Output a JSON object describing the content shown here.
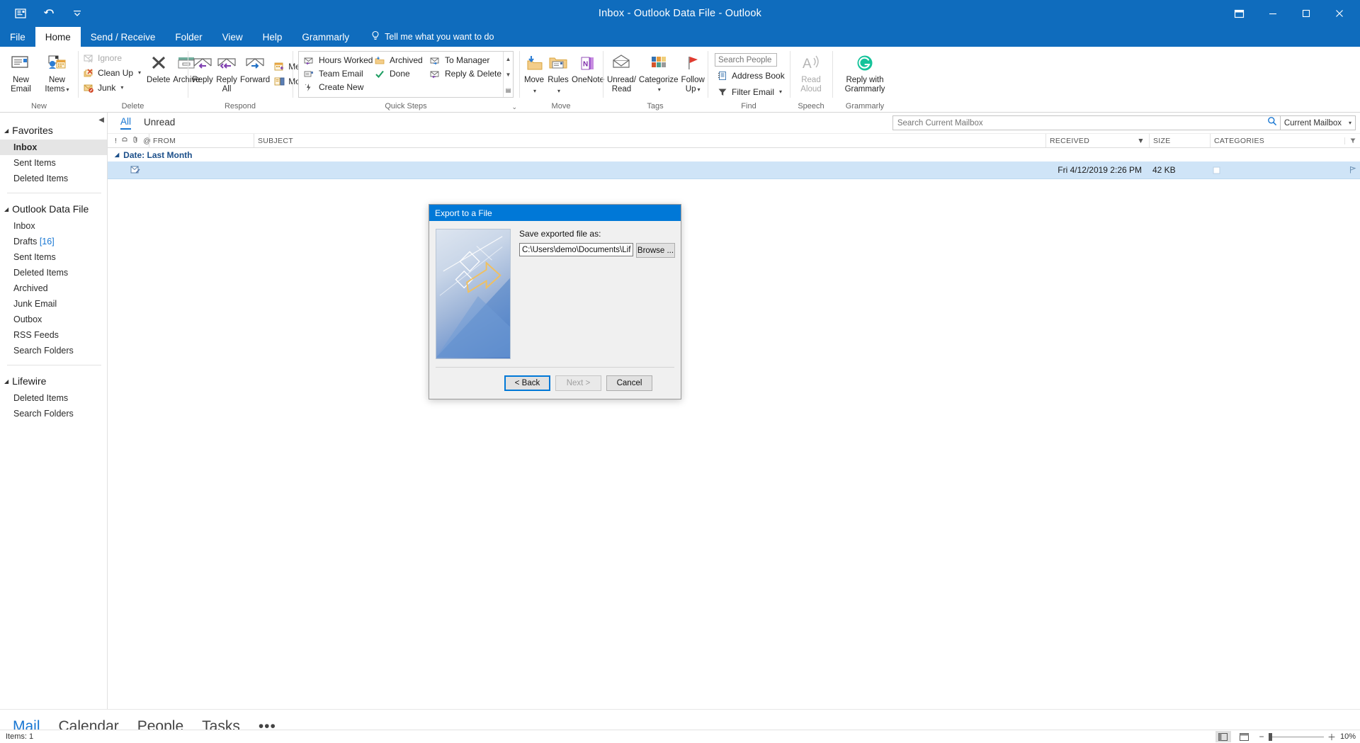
{
  "window": {
    "title": "Inbox - Outlook Data File  -  Outlook",
    "qat": [
      {
        "name": "save-icon",
        "glyph": "▤"
      },
      {
        "name": "undo-icon",
        "glyph": "↺"
      },
      {
        "name": "customize-qat-icon",
        "glyph": "▾"
      }
    ],
    "controls": {
      "ribbon_display": "⊡",
      "minimize": "—",
      "restore": "❐",
      "close": "✕"
    }
  },
  "tabs": [
    {
      "label": "File",
      "active": false
    },
    {
      "label": "Home",
      "active": true
    },
    {
      "label": "Send / Receive",
      "active": false
    },
    {
      "label": "Folder",
      "active": false
    },
    {
      "label": "View",
      "active": false
    },
    {
      "label": "Help",
      "active": false
    },
    {
      "label": "Grammarly",
      "active": false
    }
  ],
  "tell_me": "Tell me what you want to do",
  "ribbon": {
    "groups": [
      {
        "label": "New"
      },
      {
        "label": "Delete"
      },
      {
        "label": "Respond"
      },
      {
        "label": "Quick Steps"
      },
      {
        "label": "Move"
      },
      {
        "label": "Tags"
      },
      {
        "label": "Find"
      },
      {
        "label": "Speech"
      },
      {
        "label": "Grammarly"
      }
    ],
    "new": {
      "new_email": "New\nEmail",
      "new_email_l1": "New",
      "new_email_l2": "Email",
      "new_items_l1": "New",
      "new_items_l2": "Items"
    },
    "delete_small": [
      {
        "label": "Ignore",
        "disabled": true
      },
      {
        "label": "Clean Up",
        "disabled": false,
        "caret": true
      },
      {
        "label": "Junk",
        "disabled": false,
        "caret": true
      }
    ],
    "delete_big": [
      {
        "label": "Delete"
      },
      {
        "label": "Archive"
      }
    ],
    "respond": [
      {
        "label": "Reply"
      },
      {
        "label": "Reply\nAll",
        "l1": "Reply",
        "l2": "All"
      },
      {
        "label": "Forward"
      }
    ],
    "respond_small": [
      {
        "label": "Meeting"
      },
      {
        "label": "More",
        "caret": true
      }
    ],
    "quick_steps": [
      [
        "Hours Worked",
        "Team Email",
        "Create New"
      ],
      [
        "Archived",
        "Done"
      ],
      [
        "To Manager",
        "Reply & Delete"
      ]
    ],
    "move": [
      {
        "label": "Move",
        "caret": true
      },
      {
        "label": "Rules",
        "caret": true
      },
      {
        "label": "OneNote",
        "caret": false
      }
    ],
    "tags": [
      {
        "label": "Unread/\nRead",
        "l1": "Unread/",
        "l2": "Read",
        "caret": false
      },
      {
        "label": "Categorize",
        "l1": "Categorize",
        "l2": "",
        "caret": true
      },
      {
        "label": "Follow\nUp",
        "l1": "Follow",
        "l2": "Up",
        "caret": true
      }
    ],
    "find": {
      "search_people_placeholder": "Search People",
      "address_book": "Address Book",
      "filter_email": "Filter Email"
    },
    "speech": {
      "l1": "Read",
      "l2": "Aloud",
      "disabled": true
    },
    "grammarly": {
      "l1": "Reply with",
      "l2": "Grammarly"
    }
  },
  "sidebar": {
    "sections": [
      {
        "name": "Favorites",
        "items": [
          {
            "label": "Inbox",
            "selected": true
          },
          {
            "label": "Sent Items",
            "selected": false
          },
          {
            "label": "Deleted Items",
            "selected": false
          }
        ]
      },
      {
        "name": "Outlook Data File",
        "items": [
          {
            "label": "Inbox",
            "selected": false
          },
          {
            "label": "Drafts",
            "count": "[16]",
            "selected": false
          },
          {
            "label": "Sent Items",
            "selected": false
          },
          {
            "label": "Deleted Items",
            "selected": false
          },
          {
            "label": "Archived",
            "selected": false
          },
          {
            "label": "Junk Email",
            "selected": false
          },
          {
            "label": "Outbox",
            "selected": false
          },
          {
            "label": "RSS Feeds",
            "selected": false
          },
          {
            "label": "Search Folders",
            "selected": false
          }
        ]
      },
      {
        "name": "Lifewire",
        "items": [
          {
            "label": "Deleted Items",
            "selected": false
          },
          {
            "label": "Search Folders",
            "selected": false
          }
        ]
      }
    ]
  },
  "list": {
    "filters": [
      {
        "label": "All",
        "active": true
      },
      {
        "label": "Unread",
        "active": false
      }
    ],
    "search_placeholder": "Search Current Mailbox",
    "search_value": "",
    "scope": "Current Mailbox",
    "columns": {
      "from": "FROM",
      "subject": "SUBJECT",
      "received": "RECEIVED",
      "size": "SIZE",
      "categories": "CATEGORIES"
    },
    "group_label": "Date: Last Month",
    "rows": [
      {
        "from": "",
        "subject": "",
        "received": "Fri 4/12/2019 2:26 PM",
        "size": "42 KB",
        "categories": ""
      }
    ]
  },
  "bottom_nav": [
    {
      "label": "Mail",
      "active": true
    },
    {
      "label": "Calendar",
      "active": false
    },
    {
      "label": "People",
      "active": false
    },
    {
      "label": "Tasks",
      "active": false
    }
  ],
  "bottom_nav_more": "•••",
  "status": {
    "items_count": "Items: 1",
    "zoom": "10%"
  },
  "dialog": {
    "title": "Export to a File",
    "save_label": "Save exported file as:",
    "path_value": "C:\\Users\\demo\\Documents\\Lifewire\\d",
    "browse_label": "Browse ...",
    "back_label": "< Back",
    "next_label": "Next >",
    "cancel_label": "Cancel"
  },
  "colors": {
    "ribbon_blue": "#0F6CBD",
    "dialog_blue": "#0078d7",
    "accent": "#1776d2",
    "selection": "#cfe4f7"
  }
}
